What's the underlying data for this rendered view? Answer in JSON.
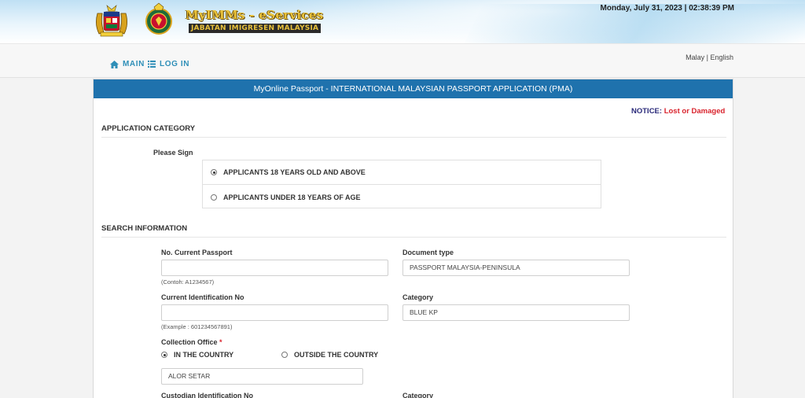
{
  "header": {
    "logo_title": "MyIMMs - eServices",
    "logo_subtitle": "JABATAN IMIGRESEN MALAYSIA",
    "datetime": "Monday, July 31, 2023  | 02:38:39 PM"
  },
  "nav": {
    "main_label": "MAIN",
    "login_label": "LOG IN",
    "language": "Malay | English"
  },
  "panel": {
    "title": "MyOnline Passport - INTERNATIONAL MALAYSIAN PASSPORT APPLICATION (PMA)",
    "notice_label": "NOTICE:",
    "notice_text": "Lost or Damaged P"
  },
  "application_category": {
    "title": "APPLICATION CATEGORY",
    "please_sign": "Please Sign",
    "options": [
      {
        "label": "APPLICANTS 18 YEARS OLD AND ABOVE",
        "checked": true
      },
      {
        "label": "APPLICANTS UNDER 18 YEARS OF AGE",
        "checked": false
      }
    ]
  },
  "search_information": {
    "title": "SEARCH INFORMATION",
    "current_passport_label": "No. Current Passport",
    "current_passport_value": "",
    "current_passport_hint": "(Contoh: A1234567)",
    "document_type_label": "Document type",
    "document_type_value": "PASSPORT MALAYSIA-PENINSULA",
    "current_id_label": "Current Identification No",
    "current_id_value": "",
    "current_id_hint": "(Example : 601234567891)",
    "category_label": "Category",
    "category_value": "BLUE KP",
    "collection_office_label": "Collection Office",
    "required_mark": "*",
    "collection_options": [
      {
        "label": "IN THE COUNTRY",
        "checked": true
      },
      {
        "label": "OUTSIDE THE COUNTRY",
        "checked": false
      }
    ],
    "collection_office_value": "ALOR SETAR",
    "custodian_id_label": "Custodian Identification No",
    "category2_label": "Category"
  },
  "colors": {
    "panel_header": "#1f72ad",
    "nav_link": "#2f8fb8",
    "notice_red": "#d9232d",
    "logo_gold": "#e9c23b"
  },
  "icons": {
    "main": "home-icon",
    "login": "list-icon",
    "crest1": "malaysia-coat-of-arms-icon",
    "crest2": "immigration-badge-icon"
  }
}
